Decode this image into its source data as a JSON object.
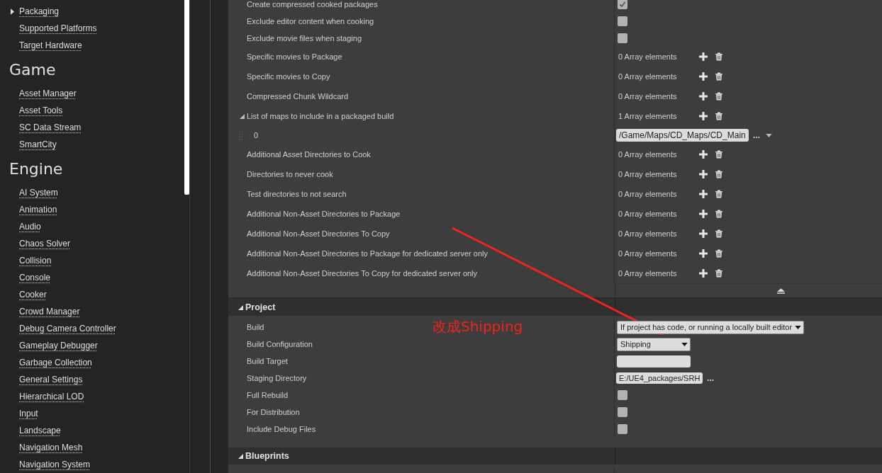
{
  "sidebar": {
    "groups": [
      {
        "items": [
          {
            "label": "Packaging",
            "kind": "collapsible"
          },
          {
            "label": "Supported Platforms",
            "kind": "link"
          },
          {
            "label": "Target Hardware",
            "kind": "link"
          }
        ]
      },
      {
        "heading": "Game",
        "items": [
          {
            "label": "Asset Manager",
            "kind": "link"
          },
          {
            "label": "Asset Tools",
            "kind": "link"
          },
          {
            "label": "SC Data Stream",
            "kind": "link"
          },
          {
            "label": "SmartCity",
            "kind": "link"
          }
        ]
      },
      {
        "heading": "Engine",
        "items": [
          {
            "label": "AI System",
            "kind": "link"
          },
          {
            "label": "Animation",
            "kind": "link"
          },
          {
            "label": "Audio",
            "kind": "link"
          },
          {
            "label": "Chaos Solver",
            "kind": "link"
          },
          {
            "label": "Collision",
            "kind": "link"
          },
          {
            "label": "Console",
            "kind": "link"
          },
          {
            "label": "Cooker",
            "kind": "link"
          },
          {
            "label": "Crowd Manager",
            "kind": "link"
          },
          {
            "label": "Debug Camera Controller",
            "kind": "link"
          },
          {
            "label": "Gameplay Debugger",
            "kind": "link"
          },
          {
            "label": "Garbage Collection",
            "kind": "link"
          },
          {
            "label": "General Settings",
            "kind": "link"
          },
          {
            "label": "Hierarchical LOD",
            "kind": "link"
          },
          {
            "label": "Input",
            "kind": "link"
          },
          {
            "label": "Landscape",
            "kind": "link"
          },
          {
            "label": "Navigation Mesh",
            "kind": "link"
          },
          {
            "label": "Navigation System",
            "kind": "link"
          }
        ]
      }
    ]
  },
  "sections": [
    {
      "rows": [
        {
          "label": "Create compressed cooked packages",
          "kind": "checkbox",
          "checked": true
        },
        {
          "label": "Exclude editor content when cooking",
          "kind": "checkbox",
          "checked": false
        },
        {
          "label": "Exclude movie files when staging",
          "kind": "checkbox",
          "checked": false
        },
        {
          "label": "Specific movies to Package",
          "kind": "array",
          "value": "0 Array elements"
        },
        {
          "label": "Specific movies to Copy",
          "kind": "array",
          "value": "0 Array elements"
        },
        {
          "label": "Compressed Chunk Wildcard",
          "kind": "array",
          "value": "0 Array elements"
        },
        {
          "label": "List of maps to include in a packaged build",
          "kind": "array_group",
          "expanded": true,
          "value": "1 Array elements"
        },
        {
          "label": "0",
          "kind": "array_item",
          "value": "/Game/Maps/CD_Maps/CD_Main"
        },
        {
          "label": "Additional Asset Directories to Cook",
          "kind": "array",
          "value": "0 Array elements"
        },
        {
          "label": "Directories to never cook",
          "kind": "array",
          "value": "0 Array elements"
        },
        {
          "label": "Test directories to not search",
          "kind": "array",
          "value": "0 Array elements"
        },
        {
          "label": "Additional Non-Asset Directories to Package",
          "kind": "array",
          "value": "0 Array elements"
        },
        {
          "label": "Additional Non-Asset Directories To Copy",
          "kind": "array",
          "value": "0 Array elements"
        },
        {
          "label": "Additional Non-Asset Directories to Package for dedicated server only",
          "kind": "array",
          "value": "0 Array elements"
        },
        {
          "label": "Additional Non-Asset Directories To Copy for dedicated server only",
          "kind": "array",
          "value": "0 Array elements"
        }
      ]
    },
    {
      "title": "Project",
      "expanded": true,
      "rows": [
        {
          "label": "Build",
          "kind": "dropdown",
          "value": "If project has code, or running a locally built editor"
        },
        {
          "label": "Build Configuration",
          "kind": "dropdown",
          "value": "Shipping"
        },
        {
          "label": "Build Target",
          "kind": "text_field"
        },
        {
          "label": "Staging Directory",
          "kind": "path",
          "value": "E:/UE4_packages/SRH"
        },
        {
          "label": "Full Rebuild",
          "kind": "checkbox",
          "checked": false
        },
        {
          "label": "For Distribution",
          "kind": "checkbox",
          "checked": false
        },
        {
          "label": "Include Debug Files",
          "kind": "checkbox",
          "checked": false
        }
      ]
    },
    {
      "title": "Blueprints",
      "expanded": true
    }
  ],
  "annotation": {
    "text": "改成Shipping"
  }
}
